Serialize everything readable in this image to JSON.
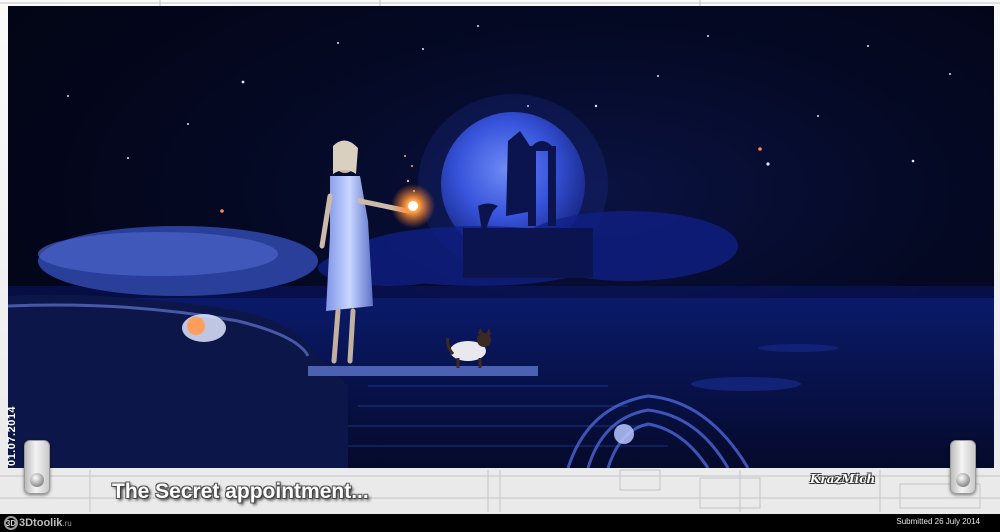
{
  "artwork": {
    "date_label": "01.07.2014",
    "title": "The Secret appointment...",
    "signature": "KrazMich"
  },
  "footer": {
    "logo_text": "3Dtoolik",
    "logo_mark": "3D",
    "logo_suffix": ".ru",
    "submitted": "Submitted 26 July 2014"
  },
  "colors": {
    "sky": "#040822",
    "moon": "#4a6cff",
    "glow": "#ff8a3a",
    "frame": "#f2f2f2"
  },
  "icons": [
    "clip-left-icon",
    "clip-right-icon",
    "site-logo-icon"
  ]
}
